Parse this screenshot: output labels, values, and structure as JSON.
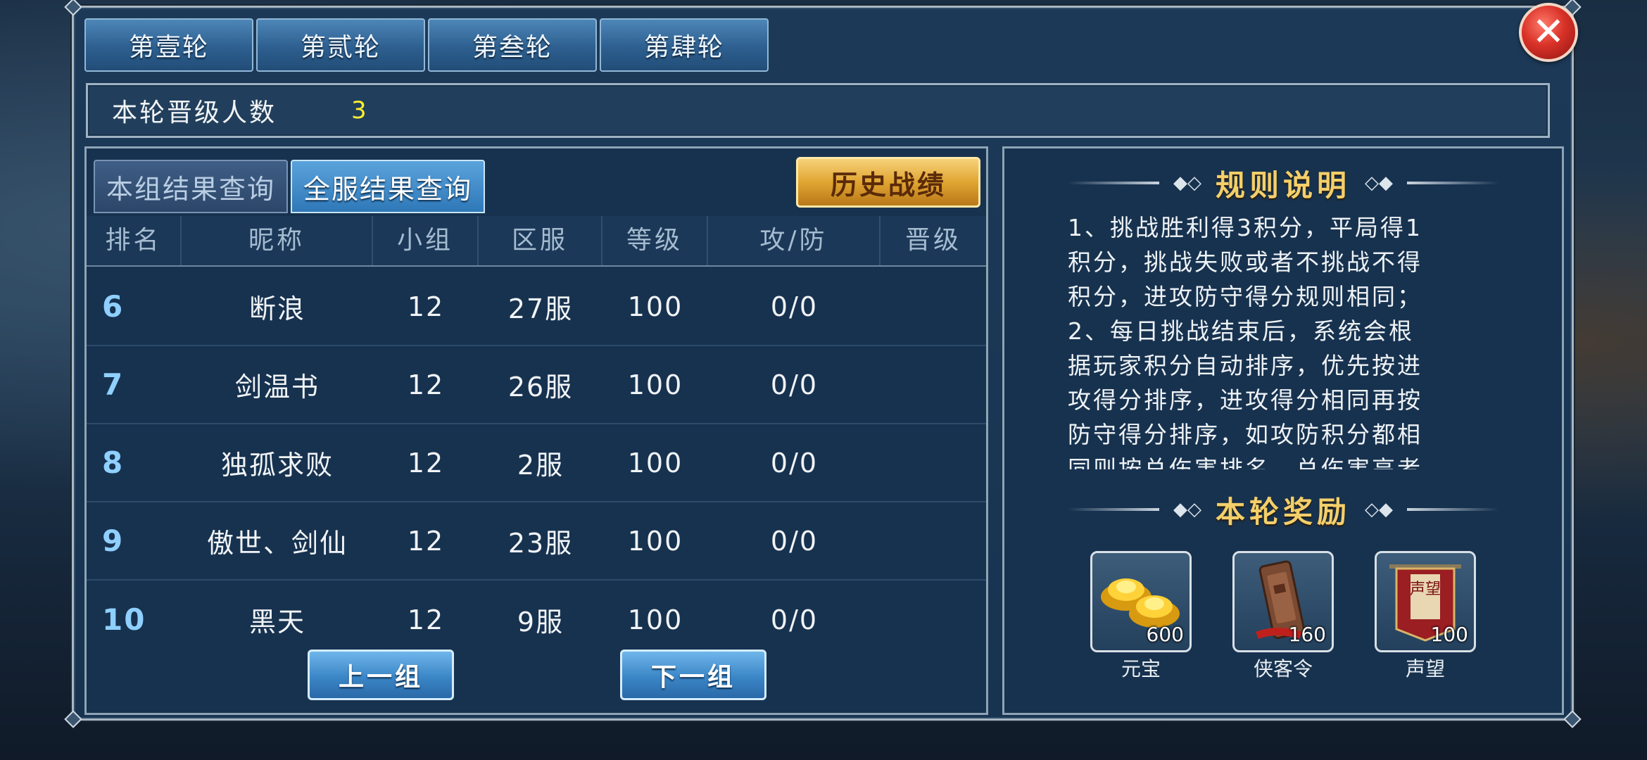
{
  "round_tabs": [
    "第壹轮",
    "第贰轮",
    "第叁轮",
    "第肆轮"
  ],
  "promote": {
    "label": "本轮晋级人数",
    "value": "3"
  },
  "sub_tabs": {
    "group": "本组结果查询",
    "server": "全服结果查询"
  },
  "history_button": "历史战绩",
  "table": {
    "headers": [
      "排名",
      "昵称",
      "小组",
      "区服",
      "等级",
      "攻/防",
      "晋级"
    ],
    "rows": [
      {
        "rank": "6",
        "name": "断浪",
        "group": "12",
        "server": "27服",
        "level": "100",
        "atk_def": "0/0",
        "promote": ""
      },
      {
        "rank": "7",
        "name": "剑温书",
        "group": "12",
        "server": "26服",
        "level": "100",
        "atk_def": "0/0",
        "promote": ""
      },
      {
        "rank": "8",
        "name": "独孤求败",
        "group": "12",
        "server": "2服",
        "level": "100",
        "atk_def": "0/0",
        "promote": ""
      },
      {
        "rank": "9",
        "name": "傲世、剑仙",
        "group": "12",
        "server": "23服",
        "level": "100",
        "atk_def": "0/0",
        "promote": ""
      },
      {
        "rank": "10",
        "name": "黑天",
        "group": "12",
        "server": "9服",
        "level": "100",
        "atk_def": "0/0",
        "promote": ""
      }
    ]
  },
  "nav": {
    "prev": "上一组",
    "next": "下一组"
  },
  "rules": {
    "title": "规则说明",
    "lines": [
      "1、挑战胜利得3积分，平局得1",
      "积分，挑战失败或者不挑战不得",
      "积分，进攻防守得分规则相同；",
      "2、每日挑战结束后，系统会根",
      "据玩家积分自动排序，优先按进",
      "攻得分排序，进攻得分相同再按",
      "防守得分排序，如攻防积分都相",
      "同则按总伤害排名，总伤害高者"
    ]
  },
  "rewards": {
    "title": "本轮奖励",
    "items": [
      {
        "name": "元宝",
        "count": "600",
        "icon": "gold-ingot-icon"
      },
      {
        "name": "侠客令",
        "count": "160",
        "icon": "token-plaque-icon"
      },
      {
        "name": "声望",
        "count": "100",
        "icon": "banner-icon",
        "banner_text": "声望"
      }
    ]
  },
  "close_icon": "close-icon"
}
